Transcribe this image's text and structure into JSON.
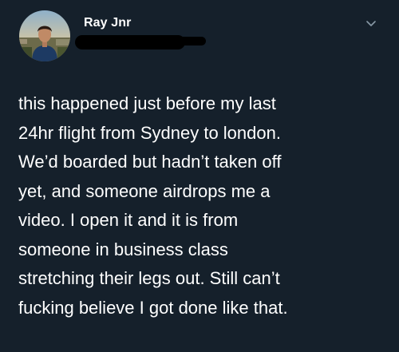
{
  "author": {
    "display_name": "Ray Jnr",
    "avatar_icon": "profile-photo-icon"
  },
  "tweet": {
    "text": "this happened just before my last\n24hr flight from Sydney to london.\nWe’d boarded but hadn’t taken off\nyet, and someone airdrops me a\nvideo. I open it and it is from\nsomeone in business class\nstretching their legs out. Still can’t\nfucking believe I got done like that."
  },
  "menu": {
    "icon": "chevron-down-icon"
  },
  "colors": {
    "background": "#15202b",
    "text": "#ffffff",
    "muted": "#8899a6",
    "redaction": "#000000"
  }
}
